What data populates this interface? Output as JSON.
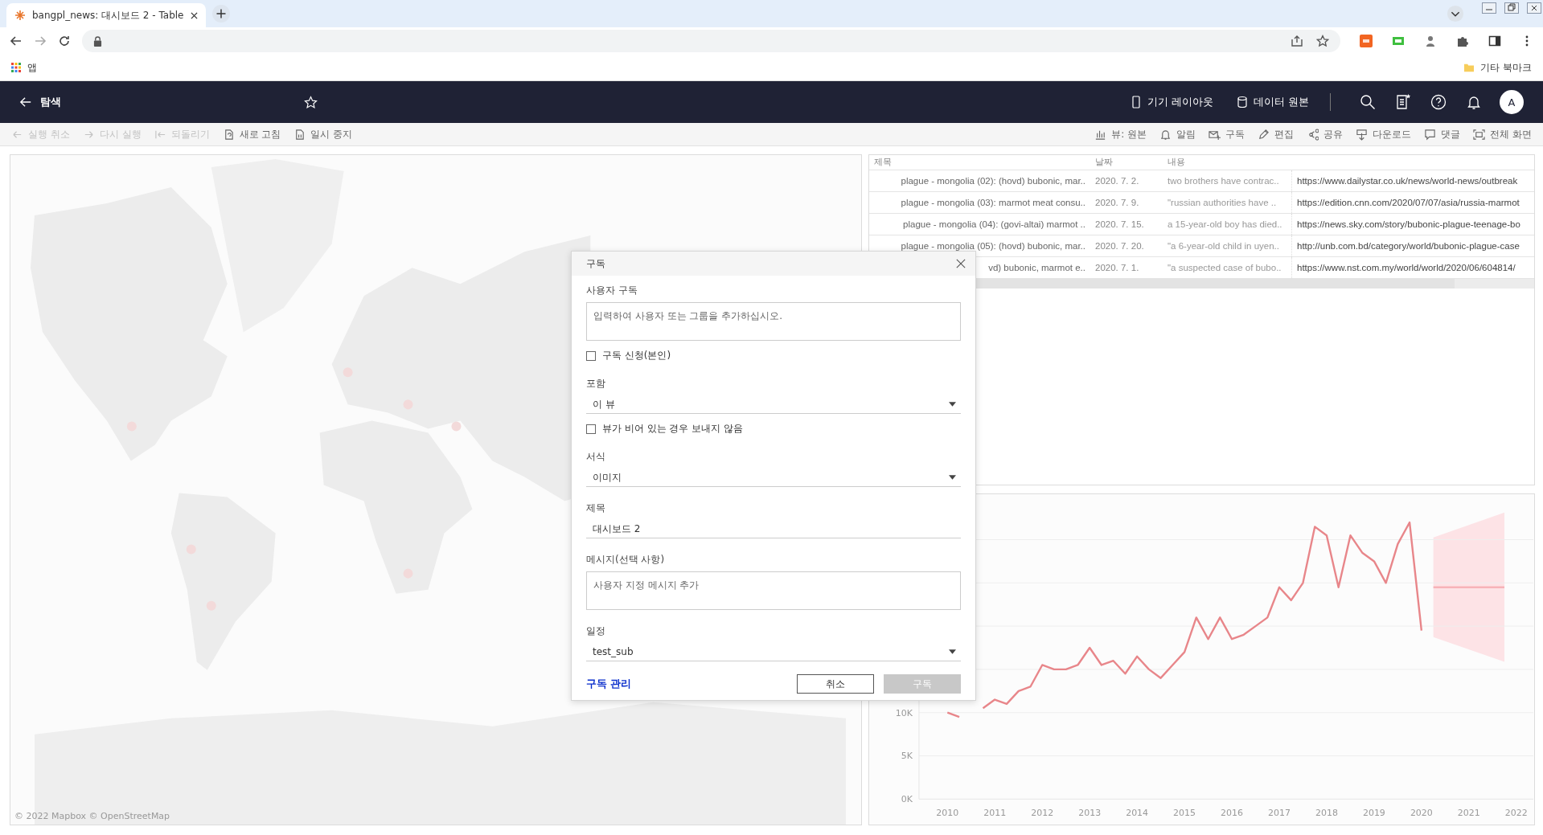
{
  "browser": {
    "tabs": [
      {
        "title": "bangpl_news: 대시보드 2 - Table",
        "selected": true
      }
    ],
    "bookmarks": [
      {
        "label": "앱",
        "kind": "apps"
      },
      {
        "label": "기타 북마크",
        "kind": "folder"
      }
    ]
  },
  "header": {
    "back_label": "탐색",
    "actions": [
      {
        "label": "기기 레이아웃",
        "kind": "device"
      },
      {
        "label": "데이터 원본",
        "kind": "database"
      }
    ],
    "avatar": "A"
  },
  "toolbar": {
    "left": [
      {
        "label": "실행 취소",
        "kind": "undo",
        "disabled": true
      },
      {
        "label": "다시 실행",
        "kind": "redo",
        "disabled": true
      },
      {
        "label": "되돌리기",
        "kind": "revert",
        "disabled": true
      },
      {
        "label": "새로 고침",
        "kind": "refresh",
        "disabled": false
      },
      {
        "label": "일시 중지",
        "kind": "pause",
        "disabled": false
      }
    ],
    "right": [
      {
        "label": "뷰: 원본",
        "kind": "view",
        "disabled": false
      },
      {
        "label": "알림",
        "kind": "alert",
        "disabled": false
      },
      {
        "label": "구독",
        "kind": "subscribe",
        "disabled": false
      },
      {
        "label": "편집",
        "kind": "edit",
        "disabled": false
      },
      {
        "label": "공유",
        "kind": "share",
        "disabled": false
      },
      {
        "label": "다운로드",
        "kind": "download",
        "disabled": false
      },
      {
        "label": "댓글",
        "kind": "comment",
        "disabled": false
      },
      {
        "label": "전체 화면",
        "kind": "fullscreen",
        "disabled": false
      }
    ]
  },
  "map": {
    "kind": "picture",
    "attribution": "© 2022 Mapbox © OpenStreetMap"
  },
  "table": {
    "columns": [
      "제목",
      "날짜",
      "내용"
    ],
    "rows": [
      {
        "title": "plague - mongolia (02): (hovd) bubonic, mar..",
        "date": "2020. 7. 2.",
        "content": "two brothers have contrac..",
        "column_4": "https://www.dailystar.co.uk/news/world-news/outbreak"
      },
      {
        "title": "plague - mongolia (03): marmot meat consu..",
        "date": "2020. 7. 9.",
        "content": "\"russian authorities have ..",
        "column_4": "https://edition.cnn.com/2020/07/07/asia/russia-marmot"
      },
      {
        "title": "plague - mongolia (04): (govi-altai) marmot ..",
        "date": "2020. 7. 15.",
        "content": "a 15-year-old boy has died..",
        "column_4": "https://news.sky.com/story/bubonic-plague-teenage-bo"
      },
      {
        "title": "plague - mongolia (05): (hovd) bubonic, mar..",
        "date": "2020. 7. 20.",
        "content": "\"a 6-year-old child in uyen..",
        "column_4": "http://unb.com.bd/category/world/bubonic-plague-case"
      },
      {
        "title": "vd) bubonic, marmot e..",
        "date": "2020. 7. 1.",
        "content": "\"a suspected case of bubo..",
        "column_4": "https://www.nst.com.my/world/world/2020/06/604814/"
      }
    ]
  },
  "chart": {
    "chart_data": {
      "type": "line",
      "x": [
        2010,
        2010.25,
        2010.75,
        2011,
        2011.25,
        2011.5,
        2011.75,
        2012,
        2012.25,
        2012.5,
        2012.75,
        2013,
        2013.25,
        2013.5,
        2013.75,
        2014,
        2014.25,
        2014.5,
        2014.75,
        2015,
        2015.25,
        2015.5,
        2015.75,
        2016,
        2016.25,
        2016.5,
        2016.75,
        2017,
        2017.25,
        2017.5,
        2017.75,
        2018,
        2018.25,
        2018.5,
        2018.75,
        2019,
        2019.25,
        2019.5,
        2019.75,
        2020,
        2020.25,
        2020.5,
        2020.75,
        2021,
        2021.25,
        2021.5,
        2021.75
      ],
      "series": [
        {
          "color": "#e8868a",
          "values": [
            10000,
            9500,
            10500,
            11500,
            11000,
            12500,
            13000,
            15500,
            15000,
            15000,
            15500,
            17500,
            15500,
            16000,
            14500,
            16500,
            15000,
            14000,
            15500,
            17000,
            21000,
            18500,
            21000,
            18500,
            19000,
            20000,
            21000,
            24500,
            23000,
            25000,
            31500,
            30500,
            24500,
            30500,
            28500,
            27500,
            25000,
            29500,
            32000,
            19500,
            null,
            null,
            null,
            null,
            null,
            null,
            null
          ]
        },
        {
          "color": "#f7b3b8",
          "values": [
            null,
            null,
            null,
            null,
            null,
            null,
            null,
            null,
            null,
            null,
            null,
            null,
            null,
            null,
            null,
            null,
            null,
            null,
            null,
            null,
            null,
            null,
            null,
            null,
            null,
            null,
            null,
            null,
            null,
            null,
            null,
            null,
            null,
            null,
            null,
            null,
            null,
            null,
            null,
            null,
            24500,
            24500,
            24500,
            24500,
            24500,
            24500,
            24500
          ]
        }
      ],
      "xlim": [
        2009.4,
        2022.36
      ],
      "ylim": [
        0,
        35000
      ],
      "xticks": [
        2010,
        2011,
        2012,
        2013,
        2014,
        2015,
        2016,
        2017,
        2018,
        2019,
        2020,
        2021,
        2022
      ],
      "yticks": [
        {
          "value": 0,
          "label": "0K"
        },
        {
          "value": 5000,
          "label": "5K"
        },
        {
          "value": 10000,
          "label": "10K"
        }
      ]
    }
  },
  "dialog": {
    "title": "구독",
    "fields": [
      {
        "kind": "textarea",
        "label": "사용자 구독",
        "placeholder": "입력하여 사용자 또는 그룹을 추가하십시오."
      },
      {
        "kind": "checkbox",
        "label": "구독 신청(본인)",
        "checked": false
      },
      {
        "kind": "select",
        "label": "포함",
        "value": "이 뷰"
      },
      {
        "kind": "checkbox",
        "label": "뷰가 비어 있는 경우 보내지 않음",
        "checked": false
      },
      {
        "kind": "select",
        "label": "서식",
        "value": "이미지"
      },
      {
        "kind": "input",
        "label": "제목",
        "value": "대시보드 2"
      },
      {
        "kind": "textarea",
        "label": "메시지(선택 사항)",
        "placeholder": "사용자 지정 메시지 추가"
      },
      {
        "kind": "select",
        "label": "일정",
        "value": "test_sub"
      }
    ],
    "manage_link": "구독 관리",
    "buttons": [
      {
        "label": "취소",
        "kind": "cancel",
        "disabled": false
      },
      {
        "label": "구독",
        "kind": "primary",
        "disabled": true
      }
    ]
  }
}
